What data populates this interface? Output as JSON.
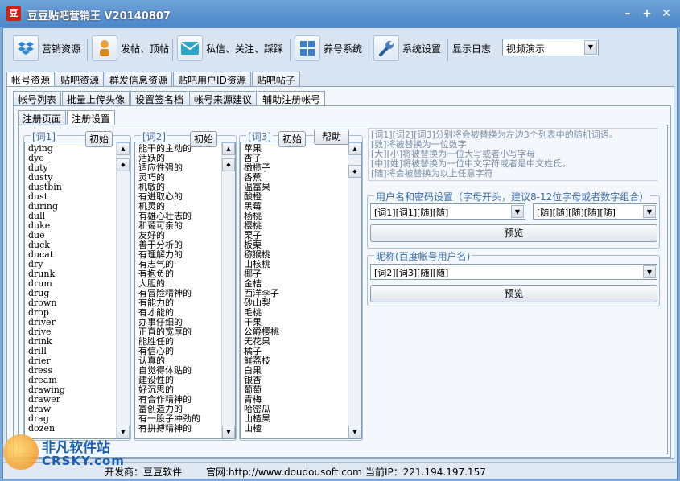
{
  "window": {
    "logo_text": "豆",
    "title": "豆豆贴吧营销王 V20140807",
    "min_icon": "minimize-icon",
    "restore_icon": "restore-icon",
    "close_icon": "close-icon"
  },
  "toolbar": {
    "items": [
      {
        "label": "营销资源",
        "icon": "dropbox-icon"
      },
      {
        "label": "发帖、顶帖",
        "icon": "person-icon"
      },
      {
        "label": "私信、关注、踩踩",
        "icon": "envelope-icon"
      },
      {
        "label": "养号系统",
        "icon": "windows-icon"
      },
      {
        "label": "系统设置",
        "icon": "wrench-icon"
      }
    ],
    "log_label": "显示日志",
    "mode_select": "视频演示"
  },
  "tabs_l1": [
    "帐号资源",
    "贴吧资源",
    "群发信息资源",
    "贴吧用户ID资源",
    "贴吧帖子"
  ],
  "tabs_l2": [
    "帐号列表",
    "批量上传头像",
    "设置签名档",
    "帐号来源建议",
    "辅助注册帐号"
  ],
  "tabs_l3": [
    "注册页面",
    "注册设置"
  ],
  "lists": {
    "word1": {
      "label": "[词1]",
      "button": "初始",
      "items": [
        "dying",
        "dye",
        "duty",
        "dusty",
        "dustbin",
        "dust",
        "during",
        "dull",
        "duke",
        "due",
        "duck",
        "ducat",
        "dry",
        "drunk",
        "drum",
        "drug",
        "drown",
        "drop",
        "driver",
        "drive",
        "drink",
        "drill",
        "drier",
        "dress",
        "dream",
        "drawing",
        "drawer",
        "draw",
        "drag",
        "dozen"
      ]
    },
    "word2": {
      "label": "[词2]",
      "button": "初始",
      "items": [
        "能干的主动的",
        "活跃的",
        "适应性强的",
        "灵巧的",
        "机敏的",
        "有进取心的",
        "机灵的",
        "有雄心壮志的",
        "和蔼可亲的",
        "友好的",
        "善于分析的",
        "有理解力的",
        "有志气的",
        "有抱负的",
        "大胆的",
        "有冒险精神的",
        "有能力的",
        "有才能的",
        "办事仔细的",
        "正直的宽厚的",
        "能胜任的",
        "有信心的",
        "认真的",
        "自觉得体贴的",
        "建设性的",
        "好沉思的",
        "有合作精神的",
        "富创造力的",
        "有一股子冲劲的",
        "有拼搏精神的"
      ]
    },
    "word3": {
      "label": "[词3]",
      "button": "初始",
      "help": "帮助",
      "items": [
        "苹果",
        "杏子",
        "橄榄子",
        "香蕉",
        "温富果",
        "酸橙",
        "黑莓",
        "杨桃",
        "樱桃",
        "栗子",
        "板栗",
        "猕猴桃",
        "山核桃",
        "椰子",
        "金桔",
        "西洋李子",
        "砂山梨",
        "毛桃",
        "干果",
        "公爵樱桃",
        "无花果",
        "橘子",
        "鲜荔枝",
        "白果",
        "银杏",
        "葡萄",
        "青梅",
        "哈密瓜",
        "山楂果",
        "山楂"
      ]
    }
  },
  "info_lines": [
    "[词1][词2][词3]分别将会被替换为左边3个列表中的随机词语。",
    "[数]将被替换为一位数字",
    "[大][小]将被替换为一位大写或者小写字母",
    "[中][姓]将被替换为一位中文字符或者是中文姓氏。",
    "[随]将会被替换为以上任意字符"
  ],
  "username_group": {
    "label": "用户名和密码设置（字母开头，建议8-12位字母或者数字组合）",
    "combo1": "[词1][词1][随][随]",
    "combo2": "[随][随][随][随][随]",
    "preview": "预览"
  },
  "nickname_group": {
    "label": "昵称(百度帐号用户名)",
    "combo": "[词2][词3][随][随]",
    "preview": "预览"
  },
  "status": {
    "developer": "开发商：豆豆软件",
    "website": "官网:http://www.doudousoft.com",
    "ip": "当前IP：221.194.197.157"
  },
  "watermark": {
    "cn": "非凡软件站",
    "en": "CRSKY.com"
  }
}
